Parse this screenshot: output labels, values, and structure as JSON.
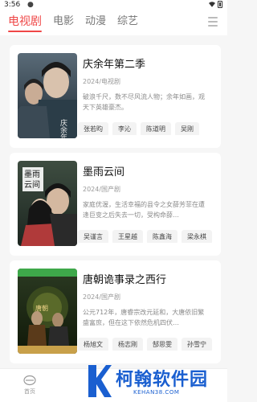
{
  "status_bar": {
    "time": "3:56",
    "indicator": "●"
  },
  "tabs": [
    {
      "label": "电视剧",
      "active": true
    },
    {
      "label": "电影",
      "active": false
    },
    {
      "label": "动漫",
      "active": false
    },
    {
      "label": "综艺",
      "active": false
    }
  ],
  "cards": [
    {
      "title": "庆余年第二季",
      "meta": "2024/电视剧",
      "desc": "破浪千尺，数不尽风流人物；余年如画，观天下英雄豪杰。",
      "poster_text": "庆余年",
      "cast": [
        "张若昀",
        "李沁",
        "陈道明",
        "吴刚"
      ]
    },
    {
      "title": "墨雨云间",
      "meta": "2024/国产剧",
      "desc": "家庭优渥，生活幸福的县令之女薛芳菲在遭逢巨变之后失去一切，受构命薛…",
      "poster_text": "墨雨云间",
      "cast": [
        "吴谨言",
        "王星越",
        "陈鑫海",
        "梁永棋"
      ]
    },
    {
      "title": "唐朝诡事录之西行",
      "meta": "2024/国产剧",
      "desc": "公元712年，唐睿宗改元延和，大唐依旧繁盛富庶，但在这下依然危机四伏…",
      "poster_text": "唐朝诡事录",
      "cast": [
        "杨旭文",
        "杨志刚",
        "郜思雯",
        "孙雪宁"
      ]
    }
  ],
  "bottom_nav": {
    "home_label": "首页"
  },
  "watermark": {
    "name": "柯翰软件园",
    "url": "KEHAN38.COM"
  },
  "colors": {
    "accent": "#ef4747",
    "watermark": "#1a5fd0"
  }
}
